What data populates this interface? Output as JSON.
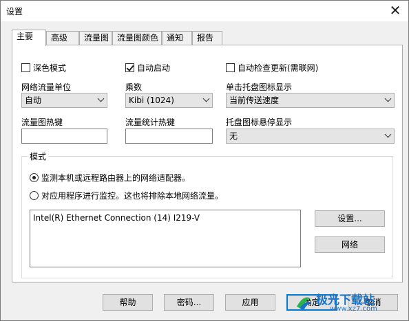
{
  "window": {
    "title": "设置",
    "close_glyph": "✕"
  },
  "tabs": [
    {
      "label": "主要",
      "active": true
    },
    {
      "label": "高级",
      "active": false
    },
    {
      "label": "流量图",
      "active": false
    },
    {
      "label": "流量图颜色",
      "active": false
    },
    {
      "label": "通知",
      "active": false
    },
    {
      "label": "报告",
      "active": false
    }
  ],
  "checkboxes": {
    "dark_mode": {
      "label": "深色模式",
      "checked": false
    },
    "autostart": {
      "label": "自动启动",
      "checked": true
    },
    "auto_update": {
      "label": "自动检查更新(需联网)",
      "checked": false
    }
  },
  "fields": {
    "unit": {
      "label": "网络流量单位",
      "value": "自动"
    },
    "multiplier": {
      "label": "乘数",
      "value": "Kibi (1024)"
    },
    "tray_click": {
      "label": "单击托盘图标显示",
      "value": "当前传送速度"
    },
    "graph_hotkey": {
      "label": "流量图热键",
      "value": ""
    },
    "stats_hotkey": {
      "label": "流量统计热键",
      "value": ""
    },
    "tray_hover": {
      "label": "托盘图标悬停显示",
      "value": "无"
    }
  },
  "mode": {
    "title": "模式",
    "option_adapter": {
      "label": "监测本机或远程路由器上的网络适配器。",
      "checked": true
    },
    "option_apps": {
      "label": "对应用程序进行监控。这也将排除本地网络流量。",
      "checked": false
    },
    "adapters": [
      "Intel(R) Ethernet Connection (14) I219-V"
    ],
    "settings_button": "设置...",
    "network_button": "网络"
  },
  "footer": {
    "help": "帮助",
    "password": "密码...",
    "apply": "应用",
    "ok": "确定",
    "cancel": "取消"
  },
  "watermark": {
    "text": "极光下载站",
    "url": "www.xz7.com"
  }
}
